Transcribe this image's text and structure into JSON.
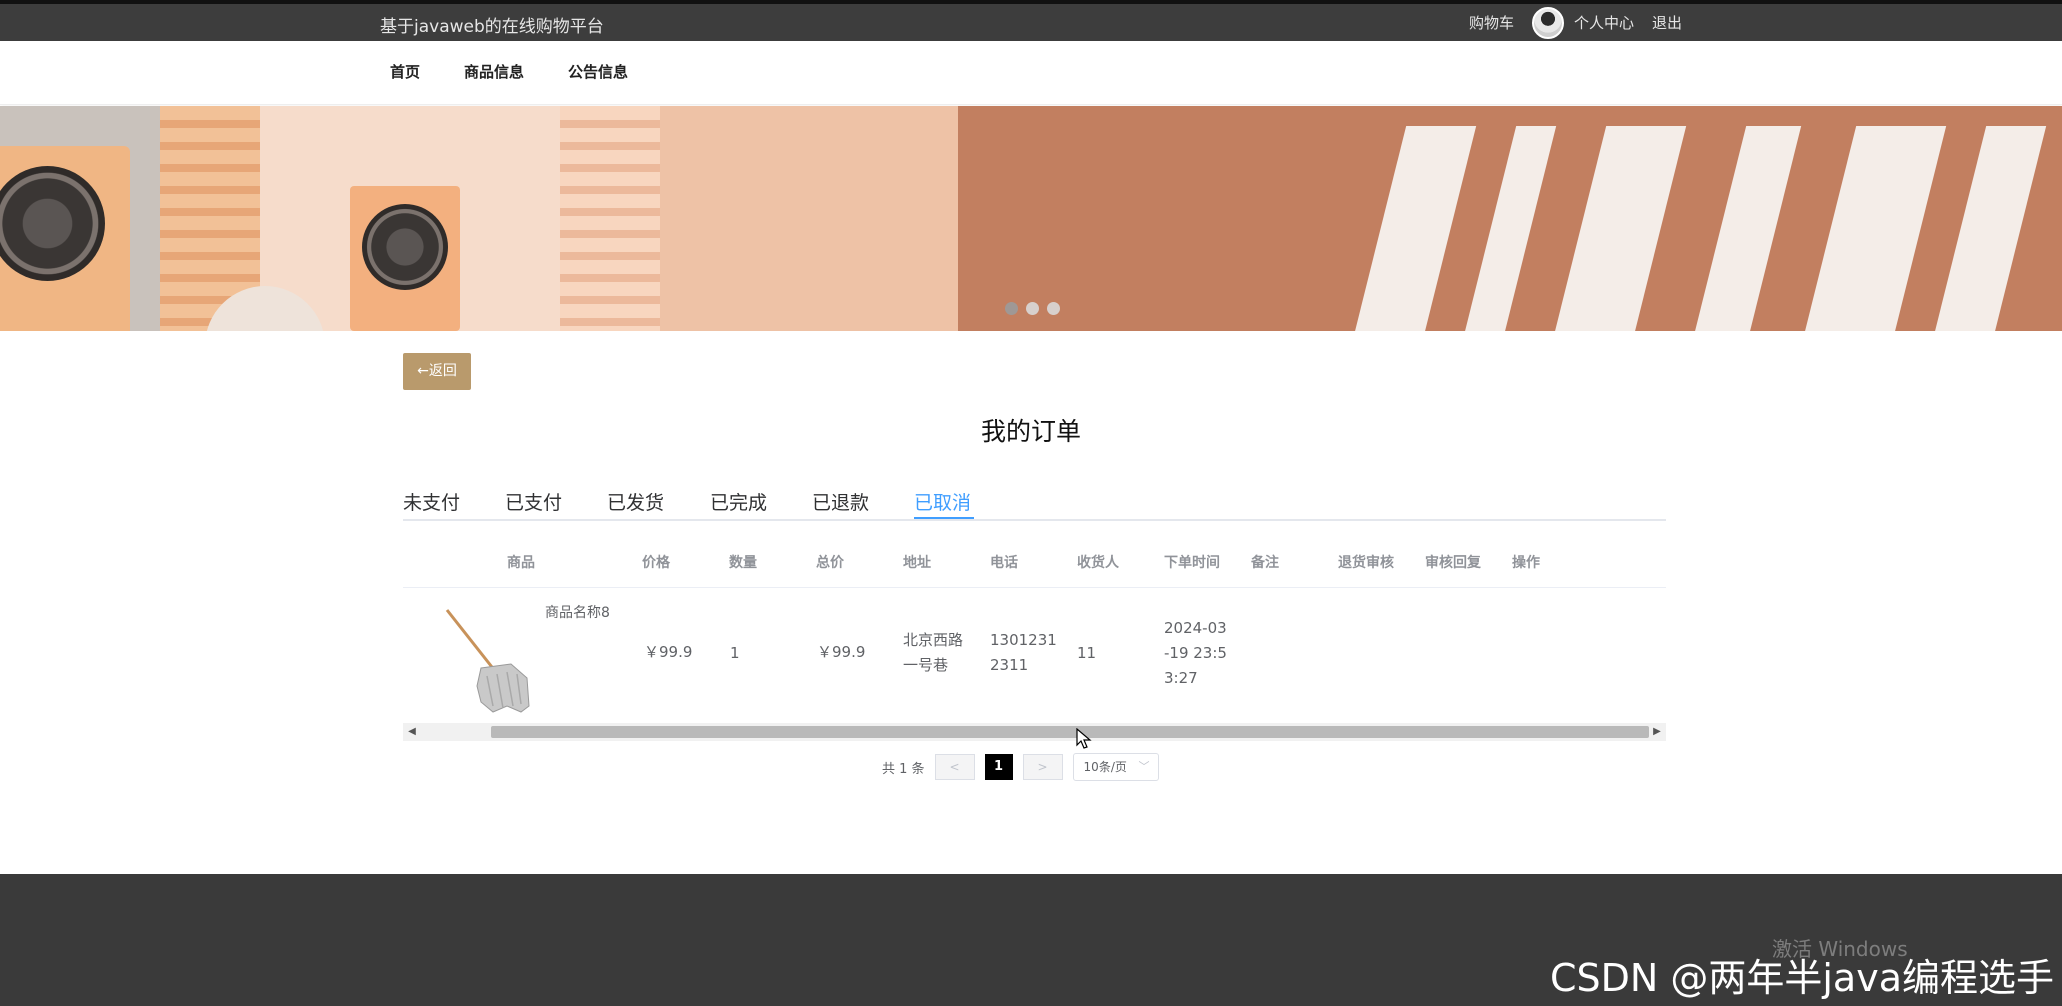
{
  "header": {
    "site_title": "基于javaweb的在线购物平台",
    "cart_label": "购物车",
    "profile_label": "个人中心",
    "logout_label": "退出"
  },
  "nav": {
    "items": [
      {
        "label": "首页"
      },
      {
        "label": "商品信息"
      },
      {
        "label": "公告信息"
      }
    ]
  },
  "banner": {
    "slide_count": 3,
    "active_slide": 1
  },
  "main": {
    "back_label": "←返回",
    "page_title": "我的订单",
    "tabs": [
      {
        "label": "未支付"
      },
      {
        "label": "已支付"
      },
      {
        "label": "已发货"
      },
      {
        "label": "已完成"
      },
      {
        "label": "已退款"
      },
      {
        "label": "已取消"
      }
    ],
    "active_tab": "已取消",
    "table": {
      "columns": [
        "商品",
        "价格",
        "数量",
        "总价",
        "地址",
        "电话",
        "收货人",
        "下单时间",
        "备注",
        "退货审核",
        "审核回复",
        "操作"
      ],
      "rows": [
        {
          "product_name": "商品名称8",
          "price": "￥99.9",
          "quantity": "1",
          "total": "￥99.9",
          "address_line1": "北京西路",
          "address_line2": "一号巷",
          "phone_line1": "1301231",
          "phone_line2": "2311",
          "receiver": "11",
          "time_line1": "2024-03",
          "time_line2": "-19 23:5",
          "time_line3": "3:27",
          "remark": "",
          "return_review": "",
          "review_reply": ""
        }
      ]
    },
    "pagination": {
      "total_text": "共 1 条",
      "prev": "<",
      "current": "1",
      "next": ">",
      "page_size": "10条/页"
    }
  },
  "footer": {
    "activate_text": "激活 Windows",
    "watermark": "CSDN @两年半java编程选手"
  }
}
